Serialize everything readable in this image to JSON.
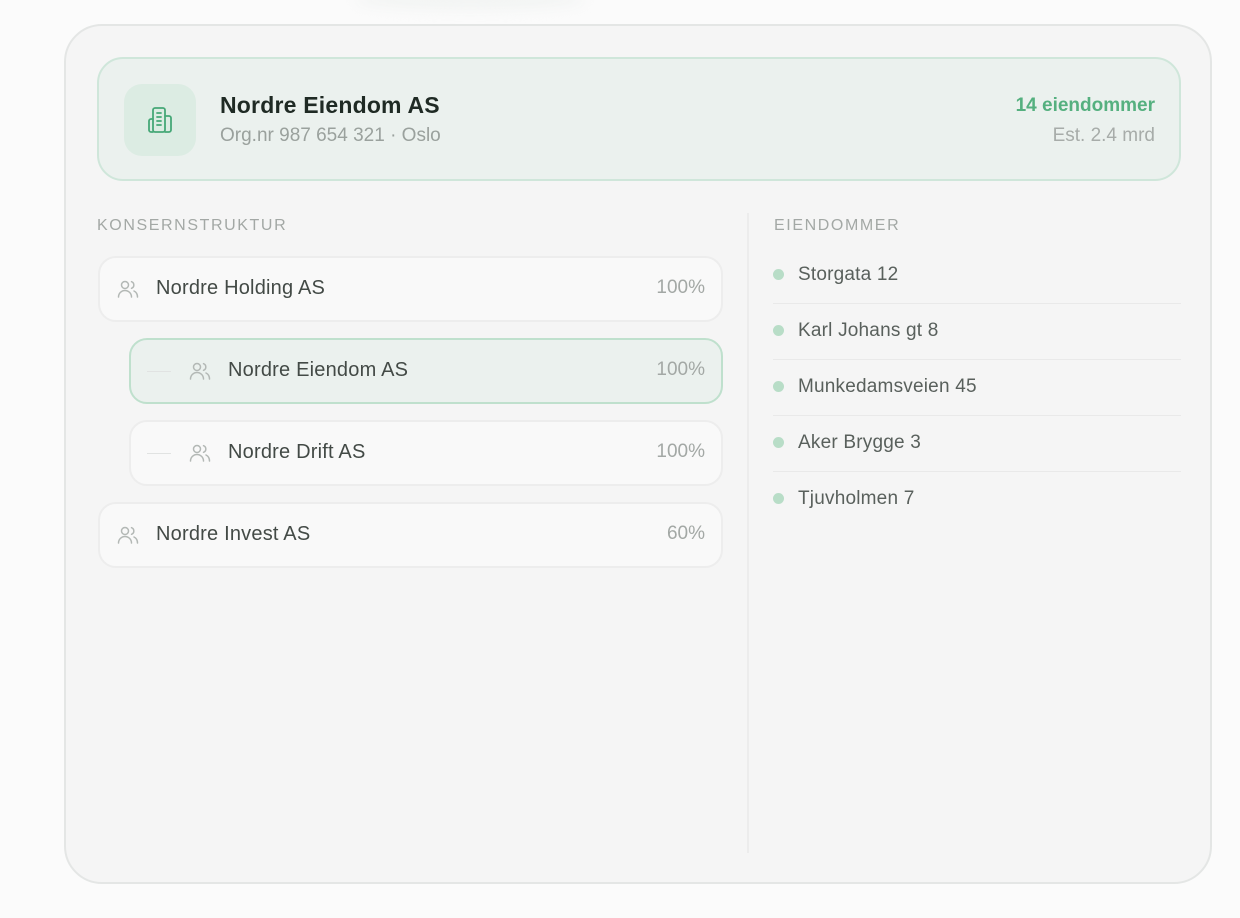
{
  "company": {
    "name": "Nordre Eiendom AS",
    "meta": "Org.nr 987 654 321 · Oslo",
    "property_count": "14 eiendommer",
    "estimate": "Est. 2.4 mrd",
    "icon": "building-icon",
    "accent_color": "#55b07f"
  },
  "structure": {
    "title": "KONSERNSTRUKTUR",
    "nodes": [
      {
        "name": "Nordre Holding AS",
        "ownership": "100%",
        "icon": "people-icon"
      },
      {
        "name": "Nordre Eiendom AS",
        "ownership": "100%",
        "icon": "people-icon",
        "selected": true
      },
      {
        "name": "Nordre Drift AS",
        "ownership": "100%",
        "icon": "people-icon"
      },
      {
        "name": "Nordre Invest AS",
        "ownership": "60%",
        "icon": "people-icon"
      }
    ]
  },
  "properties": {
    "title": "EIENDOMMER",
    "items": [
      {
        "name": "Storgata 12"
      },
      {
        "name": "Karl Johans gt 8"
      },
      {
        "name": "Munkedamsveien 45"
      },
      {
        "name": "Aker Brygge 3"
      },
      {
        "name": "Tjuvholmen 7"
      }
    ]
  }
}
